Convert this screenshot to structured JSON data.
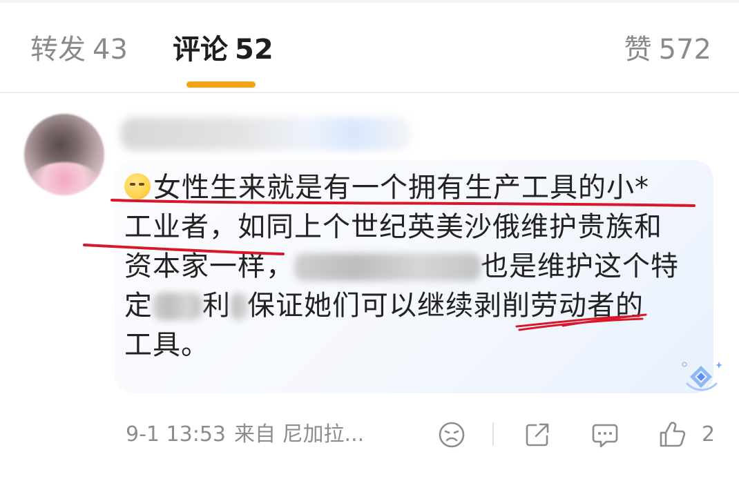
{
  "tabs": [
    {
      "label": "转发",
      "count": "43"
    },
    {
      "label": "评论",
      "count": "52"
    },
    {
      "label": "赞",
      "count": "572"
    }
  ],
  "colors": {
    "tab_indicator": "#f6a313",
    "annotation_red": "#d8182a",
    "bubble_tint": "#e9f1fd"
  },
  "comment": {
    "emoji": "thinking-face-emoji",
    "line1": "女性生来就是有一个拥有生产工具的小*",
    "line2": "工业者，如同上个世纪英美沙俄维护贵族和",
    "line3_start": "资本家一样，",
    "line3_end": "也是维护这个特",
    "line4_a": "定",
    "line4_b": "利",
    "line4_c": "保证她们可以继续剥削劳动者的",
    "line5": "工具。"
  },
  "meta": {
    "time": "9-1 13:53",
    "source": "来自 尼加拉..."
  },
  "actions": {
    "like_count": "2"
  },
  "icons": [
    "emoji-face-icon",
    "share-icon",
    "comment-icon",
    "thumbs-up-icon",
    "sparkle-icon"
  ]
}
